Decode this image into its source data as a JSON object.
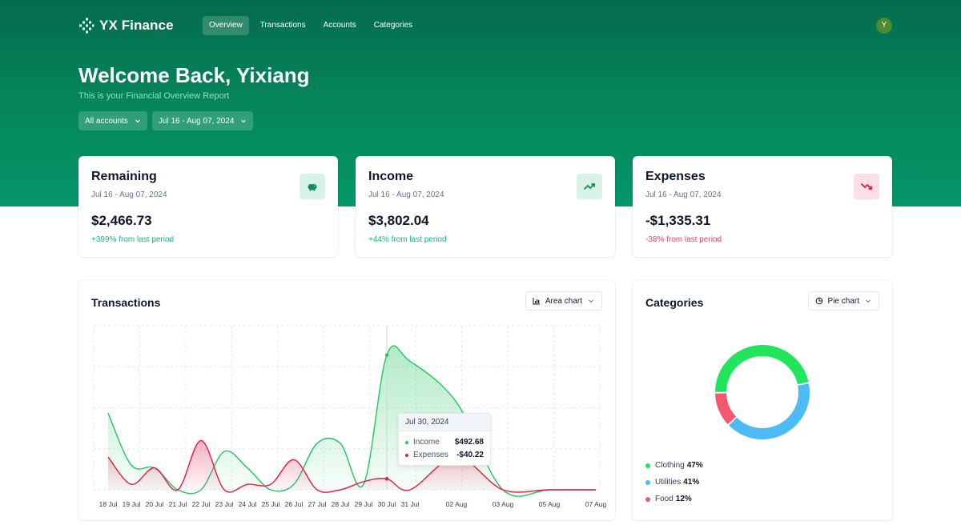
{
  "app": {
    "name": "YX Finance"
  },
  "nav": {
    "items": [
      {
        "label": "Overview",
        "active": true
      },
      {
        "label": "Transactions",
        "active": false
      },
      {
        "label": "Accounts",
        "active": false
      },
      {
        "label": "Categories",
        "active": false
      }
    ],
    "avatar_initial": "Y"
  },
  "header": {
    "title": "Welcome Back, Yixiang",
    "subtitle": "This is your Financial Overview Report",
    "account_filter": "All accounts",
    "date_filter": "Jul 16 - Aug 07, 2024"
  },
  "stats": [
    {
      "title": "Remaining",
      "date": "Jul 16 - Aug 07, 2024",
      "value": "$2,466.73",
      "change": "+399% from last period",
      "icon": "piggy-bank-icon",
      "tone": "positive"
    },
    {
      "title": "Income",
      "date": "Jul 16 - Aug 07, 2024",
      "value": "$3,802.04",
      "change": "+44% from last period",
      "icon": "trending-up-icon",
      "tone": "positive"
    },
    {
      "title": "Expenses",
      "date": "Jul 16 - Aug 07, 2024",
      "value": "-$1,335.31",
      "change": "-38% from last period",
      "icon": "trending-down-icon",
      "tone": "negative"
    }
  ],
  "colors": {
    "positive": "#10b981",
    "negative": "#f43f5e",
    "income": "#22c55e",
    "expenses": "#e11d48",
    "clothing": "#22e55e",
    "utilities": "#4dbbf5",
    "food": "#f4586f"
  },
  "transactions": {
    "title": "Transactions",
    "chart_type_label": "Area chart",
    "tooltip": {
      "date": "Jul 30, 2024",
      "income_label": "Income",
      "income_value": "$492.68",
      "expenses_label": "Expenses",
      "expenses_value": "-$40.22"
    }
  },
  "categories_panel": {
    "title": "Categories",
    "chart_type_label": "Pie chart"
  },
  "chart_data": [
    {
      "type": "area",
      "x": [
        "18 Jul",
        "19 Jul",
        "20 Jul",
        "21 Jul",
        "22 Jul",
        "23 Jul",
        "24 Jul",
        "25 Jul",
        "26 Jul",
        "27 Jul",
        "28 Jul",
        "29 Jul",
        "30 Jul",
        "31 Jul",
        "02 Aug",
        "03 Aug",
        "05 Aug",
        "07 Aug"
      ],
      "series": [
        {
          "name": "Income",
          "values": [
            280,
            90,
            80,
            0,
            0,
            140,
            80,
            0,
            20,
            170,
            170,
            20,
            492.68,
            470,
            320,
            0,
            0,
            0
          ]
        },
        {
          "name": "Expenses",
          "values": [
            120,
            20,
            80,
            0,
            180,
            0,
            20,
            20,
            110,
            0,
            0,
            30,
            40.22,
            0,
            120,
            0,
            0,
            0
          ]
        }
      ],
      "ylim": [
        0,
        600
      ]
    },
    {
      "type": "pie",
      "labels": [
        "Clothing",
        "Utilities",
        "Food"
      ],
      "values": [
        47,
        41,
        12
      ],
      "display": [
        "47%",
        "41%",
        "12%"
      ]
    }
  ]
}
